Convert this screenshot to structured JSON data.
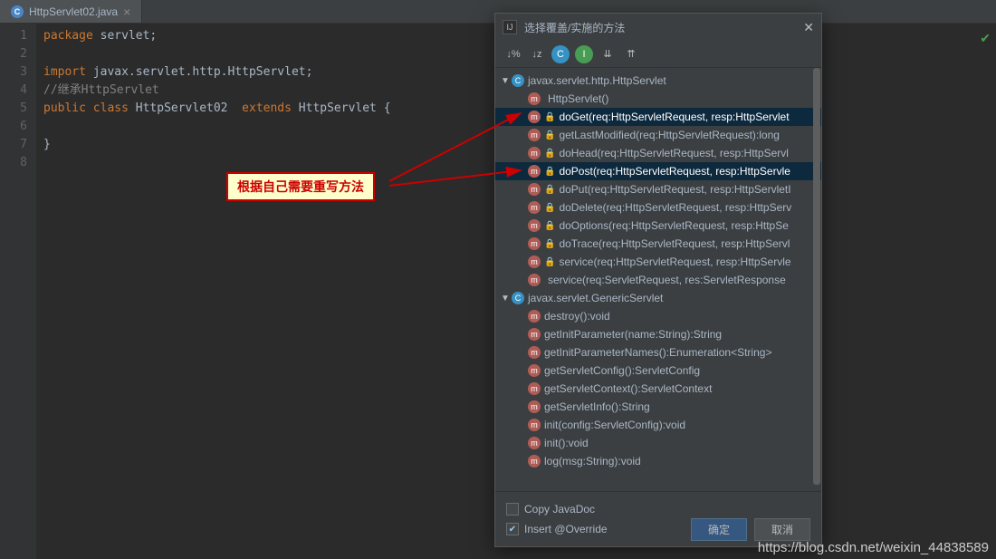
{
  "tab": {
    "filename": "HttpServlet02.java"
  },
  "lines": [
    "1",
    "2",
    "3",
    "4",
    "5",
    "6",
    "7",
    "8"
  ],
  "code": {
    "l1_kw": "package",
    "l1_rest": " servlet;",
    "l3_kw": "import",
    "l3_rest": " javax.servlet.http.HttpServlet;",
    "l4": "//继承HttpServlet",
    "l5_kw1": "public",
    "l5_kw2": "class",
    "l5_name": " HttpServlet02  ",
    "l5_kw3": "extends",
    "l5_ext": " HttpServlet {",
    "l7": "}"
  },
  "dialog": {
    "title": "选择覆盖/实施的方法",
    "class1": "javax.servlet.http.HttpServlet",
    "class2": "javax.servlet.GenericServlet",
    "methods1": [
      "HttpServlet()",
      "doGet(req:HttpServletRequest, resp:HttpServlet",
      "getLastModified(req:HttpServletRequest):long",
      "doHead(req:HttpServletRequest, resp:HttpServl",
      "doPost(req:HttpServletRequest, resp:HttpServle",
      "doPut(req:HttpServletRequest, resp:HttpServletI",
      "doDelete(req:HttpServletRequest, resp:HttpServ",
      "doOptions(req:HttpServletRequest, resp:HttpSe",
      "doTrace(req:HttpServletRequest, resp:HttpServl",
      "service(req:HttpServletRequest, resp:HttpServle",
      "service(req:ServletRequest, res:ServletResponse"
    ],
    "methods2": [
      "destroy():void",
      "getInitParameter(name:String):String",
      "getInitParameterNames():Enumeration<String>",
      "getServletConfig():ServletConfig",
      "getServletContext():ServletContext",
      "getServletInfo():String",
      "init(config:ServletConfig):void",
      "init():void",
      "log(msg:String):void"
    ],
    "copy_javadoc": "Copy JavaDoc",
    "insert_override": "Insert @Override",
    "ok": "确定",
    "cancel": "取消"
  },
  "annotation": "根据自己需要重写方法",
  "watermark": "https://blog.csdn.net/weixin_44838589"
}
